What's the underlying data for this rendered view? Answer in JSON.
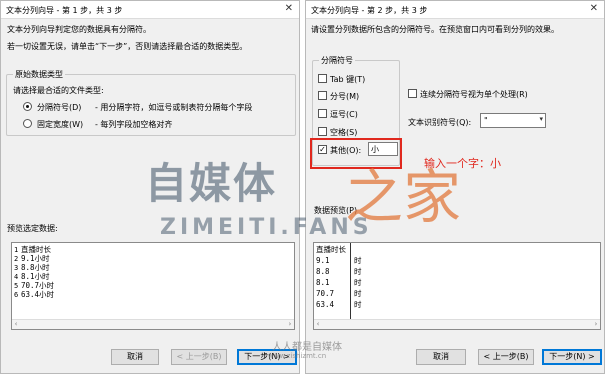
{
  "left": {
    "title": "文本分列向导 - 第 1 步，共 3 步",
    "intro": "文本分列向导判定您的数据具有分隔符。",
    "hint": "若一切设置无误，请单击“下一步”，否则请选择最合适的数据类型。",
    "group_label": "原始数据类型",
    "choose_label": "请选择最合适的文件类型:",
    "radio_delimited": "分隔符号(D)",
    "radio_delimited_desc": "- 用分隔字符，如逗号或制表符分隔每个字段",
    "radio_fixed": "固定宽度(W)",
    "radio_fixed_desc": "- 每列字段加空格对齐",
    "preview_label": "预览选定数据:",
    "preview_rows": [
      {
        "n": "1",
        "text": "直播时长"
      },
      {
        "n": "2",
        "text": "9.1小时"
      },
      {
        "n": "3",
        "text": "8.8小时"
      },
      {
        "n": "4",
        "text": "8.1小时"
      },
      {
        "n": "5",
        "text": "70.7小时"
      },
      {
        "n": "6",
        "text": "63.4小时"
      }
    ],
    "cancel": "取消",
    "back": "< 上一步(B)",
    "next": "下一步(N) >"
  },
  "right": {
    "title": "文本分列向导 - 第 2 步，共 3 步",
    "intro": "请设置分列数据所包含的分隔符号。在预览窗口内可看到分列的效果。",
    "group_label": "分隔符号",
    "tab": "Tab 键(T)",
    "semicolon": "分号(M)",
    "comma": "逗号(C)",
    "space": "空格(S)",
    "other": "其他(O):",
    "other_value": "小",
    "consecutive": "连续分隔符号视为单个处理(R)",
    "qualifier_label": "文本识别符号(Q):",
    "qualifier_value": "\"",
    "preview_label": "数据预览(P)",
    "preview_rows": [
      {
        "a": "直播时长",
        "b": ""
      },
      {
        "a": "9.1",
        "b": "时"
      },
      {
        "a": "8.8",
        "b": "时"
      },
      {
        "a": "8.1",
        "b": "时"
      },
      {
        "a": "70.7",
        "b": "时"
      },
      {
        "a": "63.4",
        "b": "时"
      }
    ],
    "cancel": "取消",
    "back": "< 上一步(B)",
    "next": "下一步(N) >"
  },
  "annotation": "输入一个字：小",
  "watermark": {
    "brand_cn": "自媒体",
    "brand_cn2": "之家",
    "brand_en": "ZIMEITI.FANS",
    "slogan": "人人都是自媒体",
    "url": "www.zishizmt.cn"
  },
  "icons": {
    "close": "close-icon",
    "dropdown": "chevron-down-icon"
  }
}
